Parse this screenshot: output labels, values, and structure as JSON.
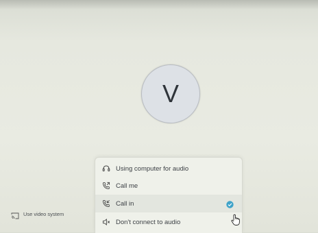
{
  "avatar": {
    "initial": "V"
  },
  "audio_menu": {
    "items": [
      {
        "label": "Using computer for audio",
        "icon": "headset-icon"
      },
      {
        "label": "Call me",
        "icon": "phone-outgoing-icon"
      },
      {
        "label": "Call in",
        "icon": "phone-incoming-icon",
        "selected": true
      },
      {
        "label": "Don't connect to audio",
        "icon": "speaker-mute-icon"
      }
    ]
  },
  "video_system": {
    "label": "Use video system",
    "icon": "cast-icon"
  },
  "colors": {
    "check": "#3fa3c9",
    "avatar_bg": "#dde1e6"
  },
  "cursor": "hand-pointer-icon"
}
